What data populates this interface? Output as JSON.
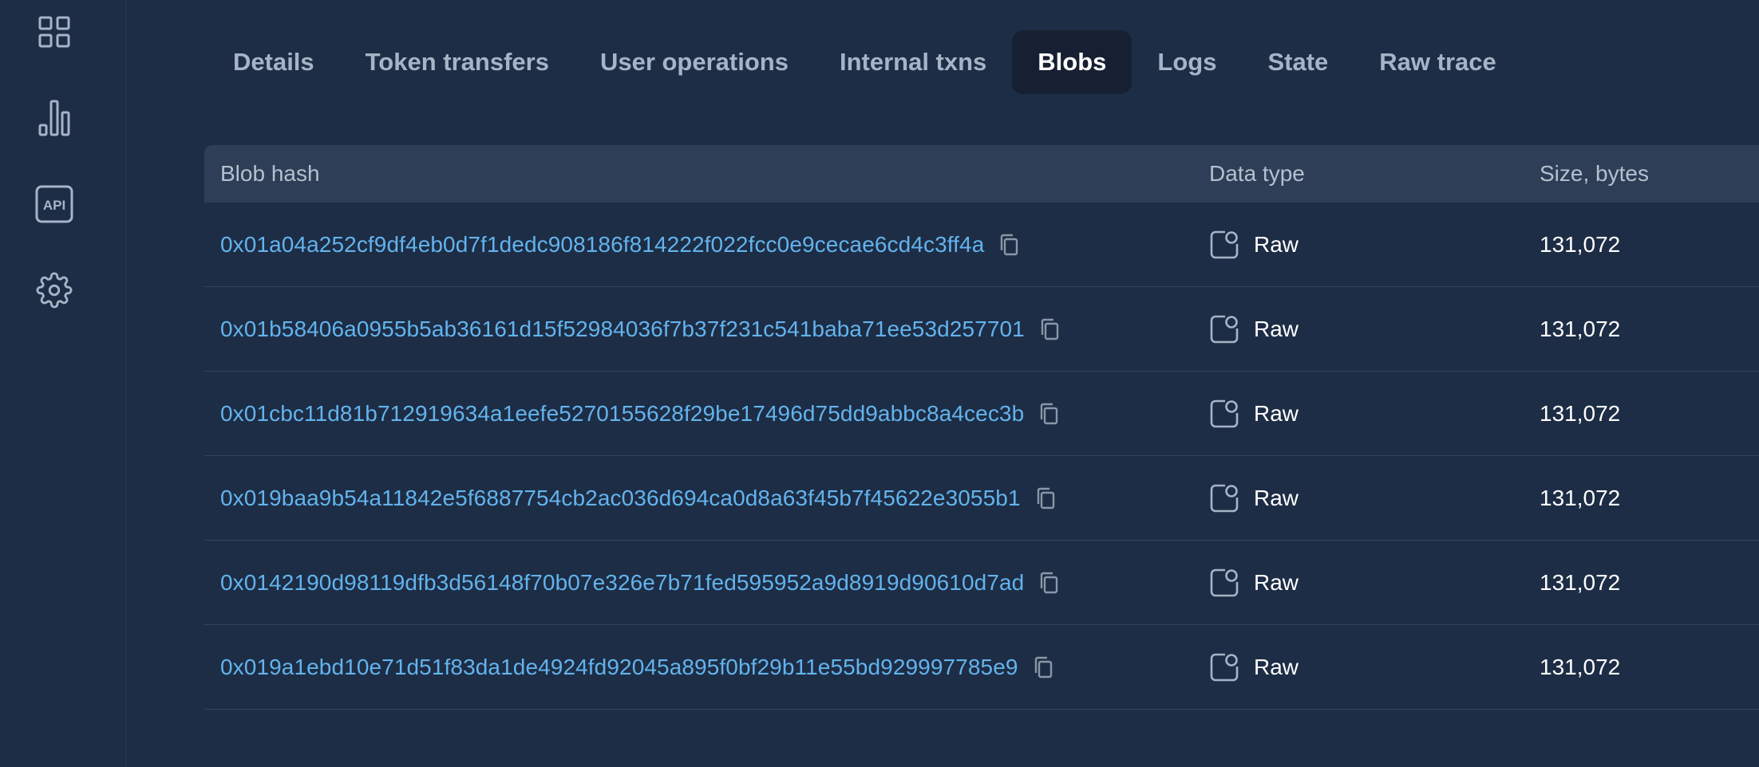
{
  "sidebar": {
    "items": [
      {
        "icon": "grid-icon"
      },
      {
        "icon": "bar-chart-icon"
      },
      {
        "icon": "api-icon",
        "label": "API"
      },
      {
        "icon": "gear-icon"
      }
    ]
  },
  "tabs": [
    {
      "label": "Details",
      "active": false
    },
    {
      "label": "Token transfers",
      "active": false
    },
    {
      "label": "User operations",
      "active": false
    },
    {
      "label": "Internal txns",
      "active": false
    },
    {
      "label": "Blobs",
      "active": true
    },
    {
      "label": "Logs",
      "active": false
    },
    {
      "label": "State",
      "active": false
    },
    {
      "label": "Raw trace",
      "active": false
    }
  ],
  "table": {
    "columns": {
      "hash": "Blob hash",
      "data_type": "Data type",
      "size": "Size, bytes"
    },
    "rows": [
      {
        "hash": "0x01a04a252cf9df4eb0d7f1dedc908186f814222f022fcc0e9cecae6cd4c3ff4a",
        "data_type": "Raw",
        "size": "131,072"
      },
      {
        "hash": "0x01b58406a0955b5ab36161d15f52984036f7b37f231c541baba71ee53d257701",
        "data_type": "Raw",
        "size": "131,072"
      },
      {
        "hash": "0x01cbc11d81b712919634a1eefe5270155628f29be17496d75dd9abbc8a4cec3b",
        "data_type": "Raw",
        "size": "131,072"
      },
      {
        "hash": "0x019baa9b54a11842e5f6887754cb2ac036d694ca0d8a63f45b7f45622e3055b1",
        "data_type": "Raw",
        "size": "131,072"
      },
      {
        "hash": "0x0142190d98119dfb3d56148f70b07e326e7b71fed595952a9d8919d90610d7ad",
        "data_type": "Raw",
        "size": "131,072"
      },
      {
        "hash": "0x019a1ebd10e71d51f83da1de4924fd92045a895f0bf29b11e55bd929997785e9",
        "data_type": "Raw",
        "size": "131,072"
      }
    ]
  },
  "colors": {
    "background": "#1d2d45",
    "header_bg": "#2e3e56",
    "active_tab_bg": "#162032",
    "link": "#63b3ed",
    "muted_text": "#a5b4c6",
    "icon": "#a5b4c6"
  }
}
